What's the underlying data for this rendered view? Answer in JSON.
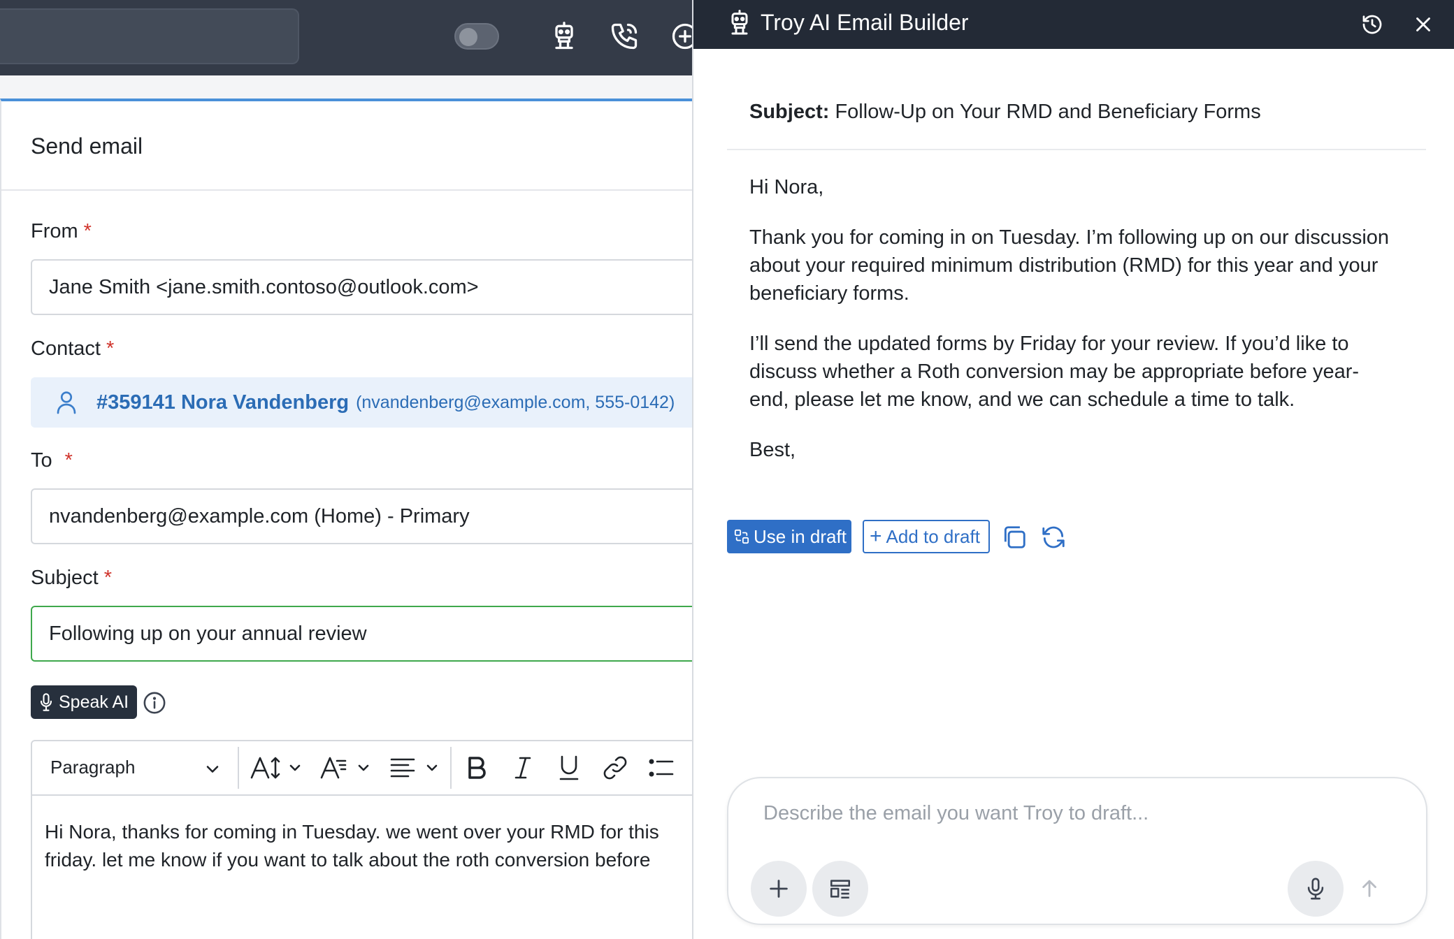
{
  "left": {
    "panel_title": "Send email",
    "from": {
      "label": "From",
      "required_mark": "*",
      "value": "Jane Smith <jane.smith.contoso@outlook.com>"
    },
    "contact": {
      "label": "Contact",
      "required_mark": "*",
      "name": "#359141 Nora Vandenberg",
      "detail": "(nvandenberg@example.com, 555-0142)"
    },
    "to": {
      "label": "To",
      "required_mark": "*",
      "value": "nvandenberg@example.com (Home) - Primary"
    },
    "subject": {
      "label": "Subject",
      "required_mark": "*",
      "value": "Following up on your annual review"
    },
    "speak_ai_label": "Speak AI",
    "editor": {
      "block_format": "Paragraph",
      "body_line1": "Hi Nora, thanks for coming in Tuesday. we went over your RMD for this",
      "body_line2": "friday. let me know if you want to talk about the roth conversion before"
    }
  },
  "ai": {
    "title": "Troy AI Email Builder",
    "subject_label": "Subject:",
    "subject_value": "Follow-Up on Your RMD and Beneficiary Forms",
    "greeting": "Hi Nora,",
    "para1": "Thank you for coming in on Tuesday. I’m following up on our discussion about your required minimum distribution (RMD) for this year and your beneficiary forms.",
    "para2": "I’ll send the updated forms by Friday for your review. If you’d like to discuss whether a Roth conversion may be appropriate before year-end, please let me know, and we can schedule a time to talk.",
    "signoff": "Best,",
    "use_in_draft_label": "Use in draft",
    "add_to_draft_label": "Add to draft",
    "add_to_draft_plus": "+",
    "composer_placeholder": "Describe the email you want Troy to draft..."
  },
  "colors": {
    "topbar": "#343b48",
    "ai_header": "#232a36",
    "primary": "#2f6fc6",
    "required": "#d0342c",
    "subject_focus": "#3fa84c",
    "contact_chip": "#e9f1fb"
  },
  "icons": [
    "robot-icon",
    "phone-icon",
    "plus-circle-icon",
    "history-icon",
    "close-icon",
    "person-icon",
    "mic-icon",
    "info-icon",
    "chevron-down-icon",
    "font-size-icon",
    "text-style-icon",
    "align-icon",
    "bold-icon",
    "italic-icon",
    "underline-icon",
    "link-icon",
    "bullet-list-icon",
    "copy-icon",
    "regenerate-icon",
    "plus-icon",
    "template-icon",
    "send-arrow-icon"
  ]
}
